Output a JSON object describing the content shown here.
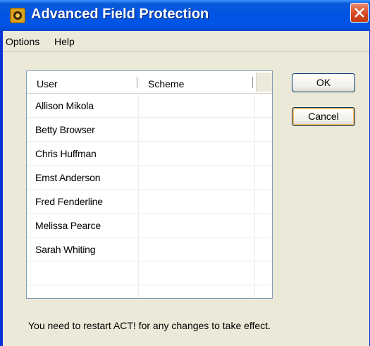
{
  "window": {
    "title": "Advanced Field Protection"
  },
  "menu": {
    "options": "Options",
    "help": "Help"
  },
  "table": {
    "columns": [
      "User",
      "Scheme"
    ],
    "rows": [
      {
        "user": "Allison Mikola",
        "scheme": ""
      },
      {
        "user": "Betty Browser",
        "scheme": ""
      },
      {
        "user": "Chris Huffman",
        "scheme": ""
      },
      {
        "user": "Emst Anderson",
        "scheme": ""
      },
      {
        "user": "Fred Fenderline",
        "scheme": ""
      },
      {
        "user": "Melissa Pearce",
        "scheme": ""
      },
      {
        "user": "Sarah Whiting",
        "scheme": ""
      }
    ]
  },
  "buttons": {
    "ok": "OK",
    "cancel": "Cancel"
  },
  "status": {
    "message": "You need to restart ACT! for any changes to take effect."
  },
  "icons": {
    "app": "act-app-icon",
    "close": "close-icon"
  },
  "colors": {
    "titlebar": "#0054e3",
    "dialog_bg": "#ece9d8",
    "close_button": "#d5461e",
    "list_border": "#7f9db9"
  }
}
